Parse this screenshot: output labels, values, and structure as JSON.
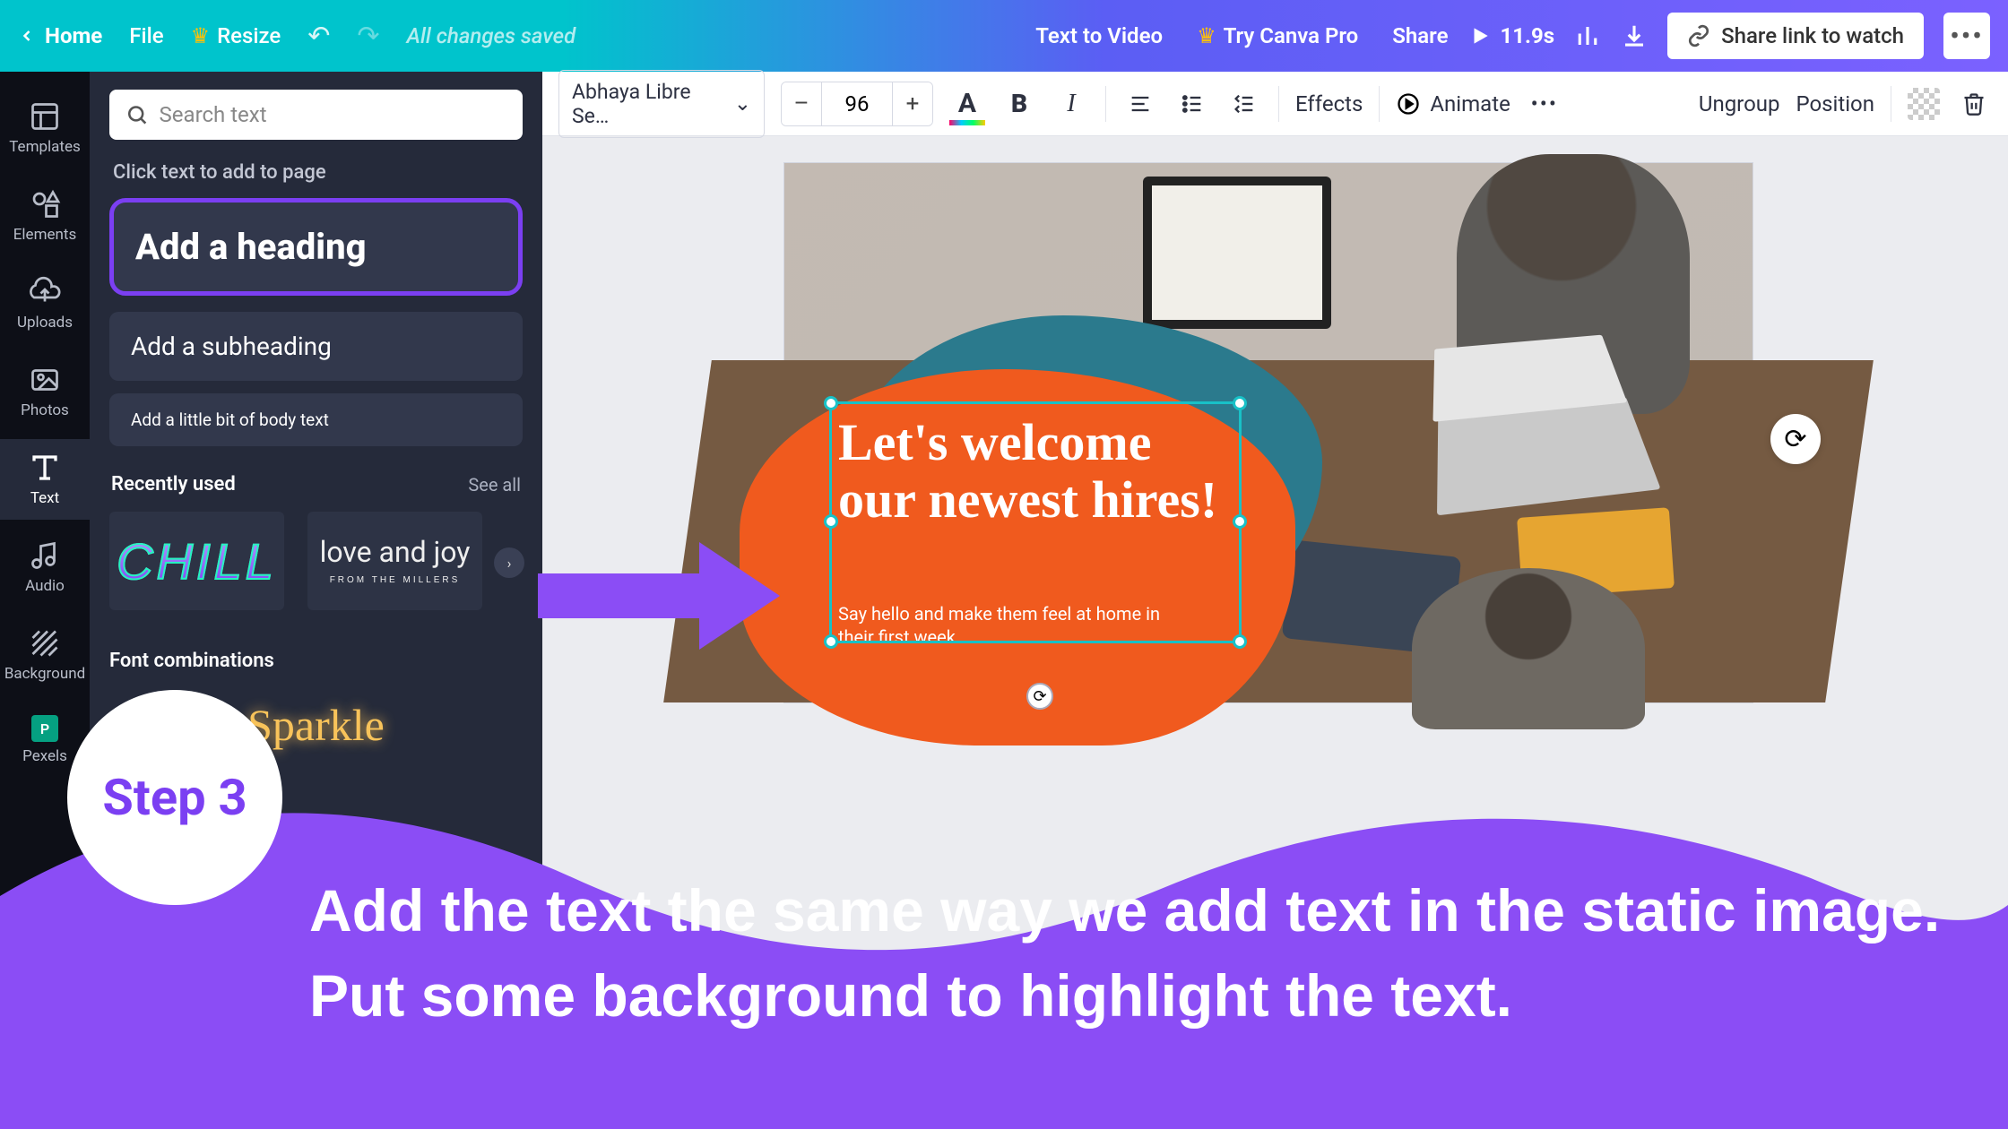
{
  "topbar": {
    "home": "Home",
    "file": "File",
    "resize": "Resize",
    "saved": "All changes saved",
    "text_to_video": "Text to Video",
    "try_pro": "Try Canva Pro",
    "share": "Share",
    "duration": "11.9s",
    "share_link": "Share link to watch"
  },
  "rail": {
    "templates": "Templates",
    "elements": "Elements",
    "uploads": "Uploads",
    "photos": "Photos",
    "text": "Text",
    "audio": "Audio",
    "background": "Background",
    "pexels": "Pexels"
  },
  "panel": {
    "search_placeholder": "Search text",
    "hint": "Click text to add to page",
    "add_heading": "Add a heading",
    "add_sub": "Add a subheading",
    "add_body": "Add a little bit of body text",
    "recent_title": "Recently used",
    "see_all": "See all",
    "thumb1": "CHILL",
    "thumb2": "love and joy",
    "thumb2_sub": "FROM THE MILLERS",
    "font_combos": "Font combinations",
    "sparkle": "Sparkle"
  },
  "toolbar": {
    "font": "Abhaya Libre Se…",
    "size": "96",
    "effects": "Effects",
    "animate": "Animate",
    "ungroup": "Ungroup",
    "position": "Position"
  },
  "canvas": {
    "headline": "Let's welcome our newest hires!",
    "subhead": "Say hello and make them feel at home in their first week."
  },
  "callout": {
    "step": "Step 3",
    "text": "Add the text the same way we add text in the static image. Put some background to highlight the text."
  },
  "colors": {
    "brand_purple": "#7b3ff2",
    "teal": "#2b7a8d",
    "orange": "#f05a1e"
  }
}
